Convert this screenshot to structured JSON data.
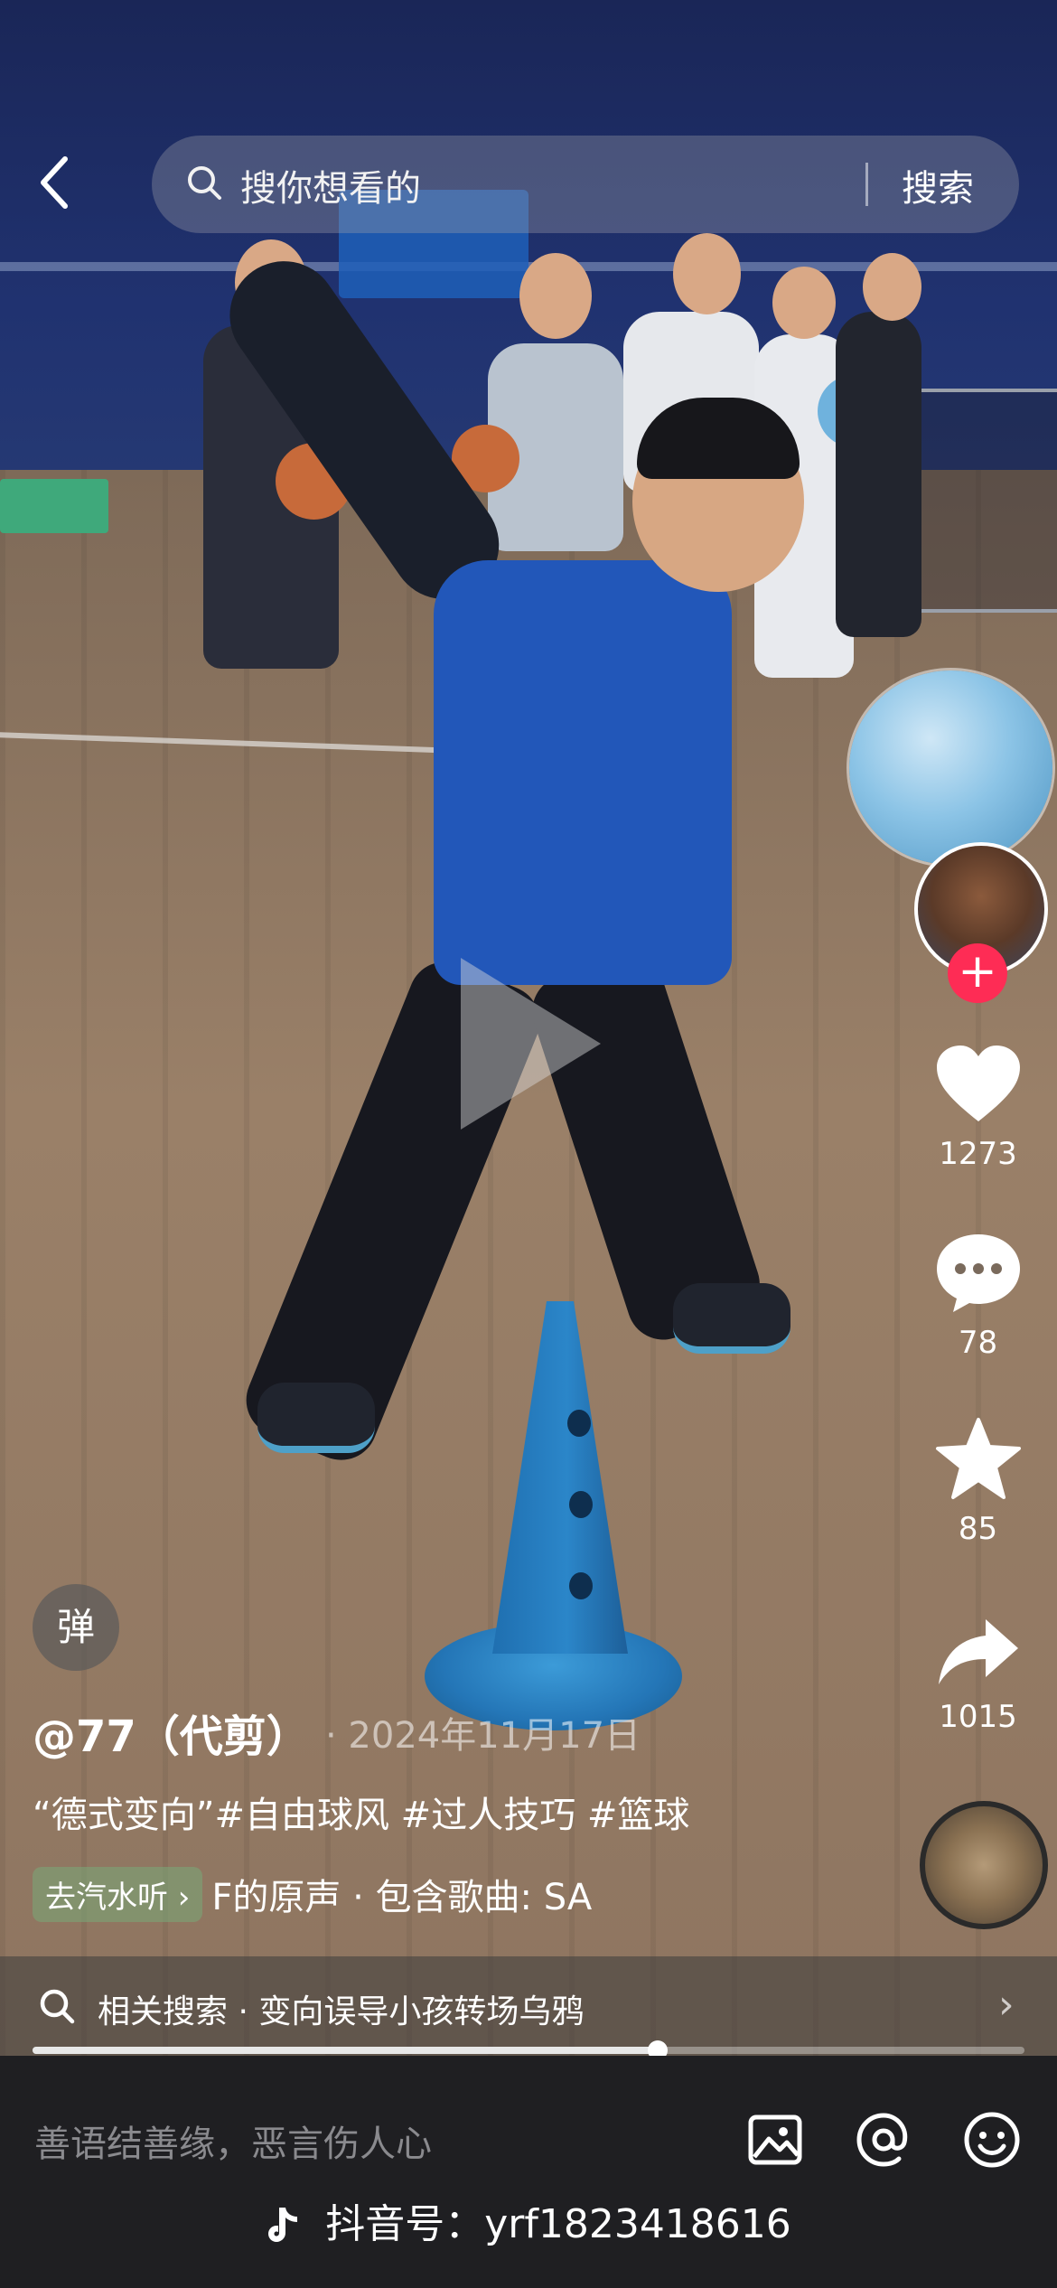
{
  "search": {
    "placeholder": "搜你想看的",
    "button_label": "搜索"
  },
  "video": {
    "progress": 0.63
  },
  "rail": {
    "like_count": "1273",
    "comment_count": "78",
    "favorite_count": "85",
    "share_count": "1015",
    "follow_symbol": "+"
  },
  "post": {
    "danmu_label": "弹",
    "author": "@77（代剪）",
    "date": "· 2024年11月17日",
    "caption": "“德式变向”#自由球风 #过人技巧 #篮球",
    "music_tag": "去汽水听 ›",
    "music_text": "F的原声 · 包含歌曲: SA"
  },
  "related": {
    "text": "相关搜索 · 变向误导小孩转场乌鸦",
    "chevron": "›"
  },
  "comment": {
    "placeholder": "善语结善缘，恶言伤人心"
  },
  "watermark": {
    "text": "抖音号：yrf1823418616"
  },
  "colors": {
    "follow_red": "#fe2c55",
    "jersey_blue": "#2257b9",
    "comment_bar_bg": "#1f1f22"
  },
  "icons": [
    "back-icon",
    "search-icon",
    "heart-icon",
    "comment-icon",
    "star-icon",
    "share-icon",
    "image-icon",
    "at-icon",
    "emoji-icon",
    "douyin-logo-icon",
    "chevron-right-icon"
  ]
}
